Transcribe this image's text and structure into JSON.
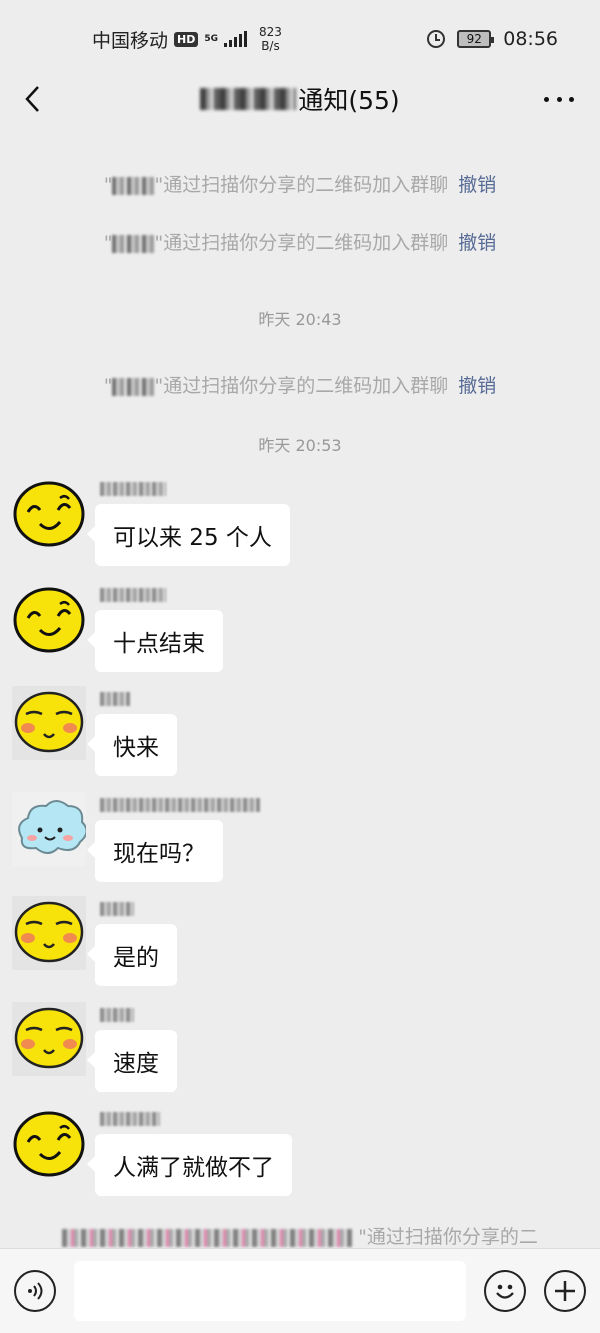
{
  "status_bar": {
    "carrier": "中国移动",
    "hd": "HD",
    "net": "5G",
    "speed_value": "823",
    "speed_unit": "B/s",
    "battery": "92",
    "time": "08:56"
  },
  "header": {
    "title_suffix": "通知(55)"
  },
  "system_messages": [
    {
      "text": "\"通过扫描你分享的二维码加入群聊",
      "action": "撤销"
    },
    {
      "text": "\"通过扫描你分享的二维码加入群聊",
      "action": "撤销"
    },
    {
      "text": "\"通过扫描你分享的二维码加入群聊",
      "action": "撤销"
    }
  ],
  "timestamps": [
    "昨天 20:43",
    "昨天 20:53"
  ],
  "messages": [
    {
      "text": "可以来 25 个人",
      "avatar": "smiley-icon"
    },
    {
      "text": "十点结束",
      "avatar": "smiley-icon"
    },
    {
      "text": "快来",
      "avatar": "blush-face-icon"
    },
    {
      "text": "现在吗？",
      "avatar": "cloud-face-icon"
    },
    {
      "text": "是的",
      "avatar": "blush-face-icon"
    },
    {
      "text": "速度",
      "avatar": "blush-face-icon"
    },
    {
      "text": "人满了就做不了",
      "avatar": "smiley-icon"
    }
  ],
  "bottom_system": {
    "text": "\"通过扫描你分享的二"
  },
  "colors": {
    "background": "#ededed",
    "link": "#576b95",
    "bubble": "#ffffff",
    "avatar_yellow": "#f7e20a"
  }
}
